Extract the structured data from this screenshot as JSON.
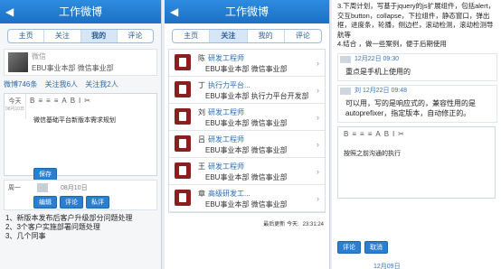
{
  "p1": {
    "title": "工作微博",
    "back": "◀",
    "tabs": [
      "主页",
      "关注",
      "我的",
      "评论"
    ],
    "active_tab": 2,
    "profile": {
      "name": "微信",
      "dept": "EBU事业本部 微信事业部"
    },
    "stats": [
      "微博746条",
      "关注我6人",
      "关注我2人"
    ],
    "editor": {
      "day": "今天",
      "date": "08月10日",
      "text": "微信基础平台新版本需求规划",
      "save": "保存"
    },
    "entry": {
      "day": "周一",
      "date": "08月10日",
      "actions": [
        "编辑",
        "评论",
        "私评"
      ]
    },
    "list": [
      "1、新版本发布后客户升级部分问题处理",
      "2、3个客户实施部署问题处理",
      "3、几个同事"
    ]
  },
  "p2": {
    "title": "工作微博",
    "back": "◀",
    "tabs": [
      "主页",
      "关注",
      "我的",
      "评论"
    ],
    "active_tab": 1,
    "users": [
      {
        "name": "陈",
        "role": "研发工程师",
        "dept": "EBU事业本部 微信事业部"
      },
      {
        "name": "丁",
        "role": "执行力平台...",
        "dept": "EBU事业本部 执行力平台开发部"
      },
      {
        "name": "刘",
        "role": "研发工程师",
        "dept": "EBU事业本部 微信事业部"
      },
      {
        "name": "吕",
        "role": "研发工程师",
        "dept": "EBU事业本部 微信事业部"
      },
      {
        "name": "王",
        "role": "研发工程师",
        "dept": "EBU事业本部 微信事业部"
      },
      {
        "name": "章",
        "role": "高级研发工...",
        "dept": "EBU事业本部 微信事业部"
      }
    ],
    "footer": {
      "label": "最后更新 今天:",
      "time": "23:31:24"
    }
  },
  "p3": {
    "para": "3.下周计划，写基于jquery的js扩展组件，包括alert，交互button，collapse，下拉组件，静态窗口，弹出框，进度条，轮播，侧边栏，滚动检测，滚动检测导航等\n4.结合            ，做一些案例，便于后期使用",
    "comments": [
      {
        "date": "12月22日 09:30",
        "text": "重点是手机上使用的"
      },
      {
        "name": "刘",
        "date": "12月22日 09:48",
        "text": "可以用，写的是响应式的，兼容性用的是autoprefixer，指定版本，自动修正的。"
      }
    ],
    "editor_text": "按照之前沟通的执行",
    "buttons": [
      "评论",
      "取消"
    ],
    "last": "12月09日"
  },
  "toolbar_icons": [
    "B",
    "≡",
    "≡",
    "≡",
    "A",
    "B",
    "I",
    "✂"
  ]
}
